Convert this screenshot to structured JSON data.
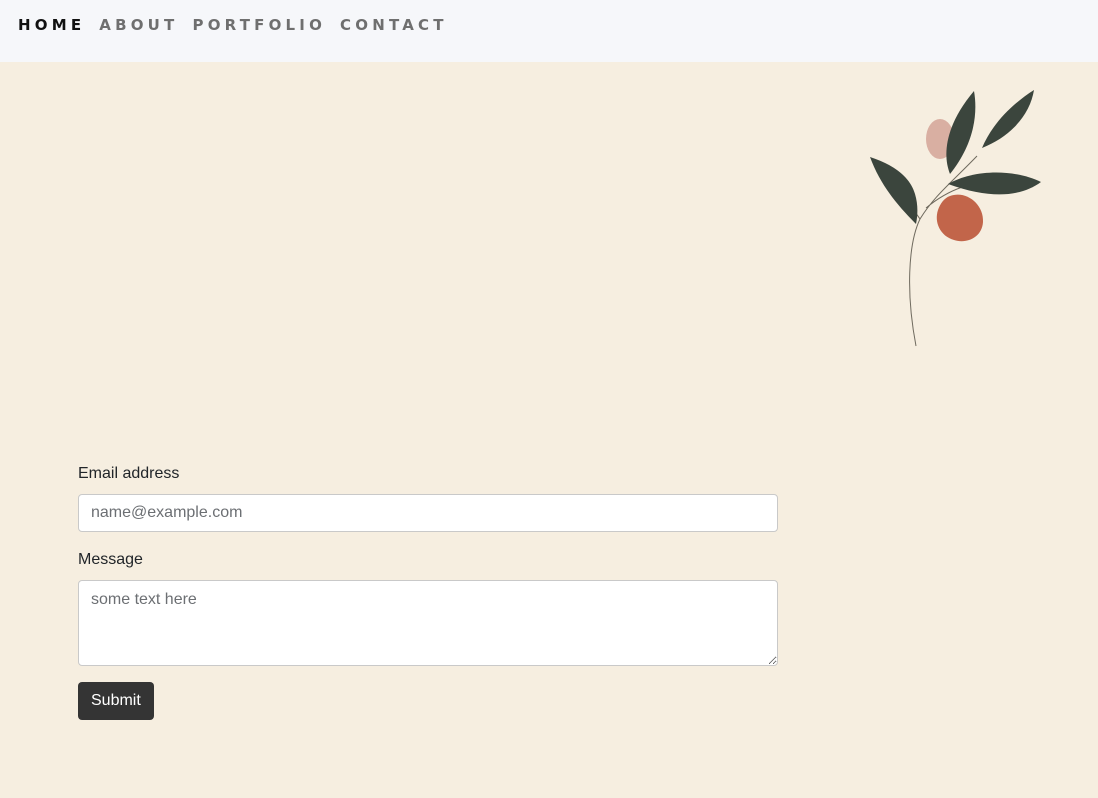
{
  "nav": {
    "items": [
      {
        "label": "HOME",
        "active": true
      },
      {
        "label": "ABOUT",
        "active": false
      },
      {
        "label": "PORTFOLIO",
        "active": false
      },
      {
        "label": "CONTACT",
        "active": false
      }
    ]
  },
  "decoration": {
    "icon": "leaf-branch-icon",
    "colors": {
      "leaf": "#3b453d",
      "berry_large": "#c2654a",
      "berry_small": "#d9afa2",
      "stem": "#6f6a5e"
    }
  },
  "form": {
    "email_label": "Email address",
    "email_placeholder": "name@example.com",
    "email_value": "",
    "message_label": "Message",
    "message_placeholder": "some text here",
    "message_value": "",
    "submit_label": "Submit"
  },
  "colors": {
    "page_background": "#f6eee0",
    "navbar_background": "#f6f7fa",
    "button_background": "#343434"
  }
}
